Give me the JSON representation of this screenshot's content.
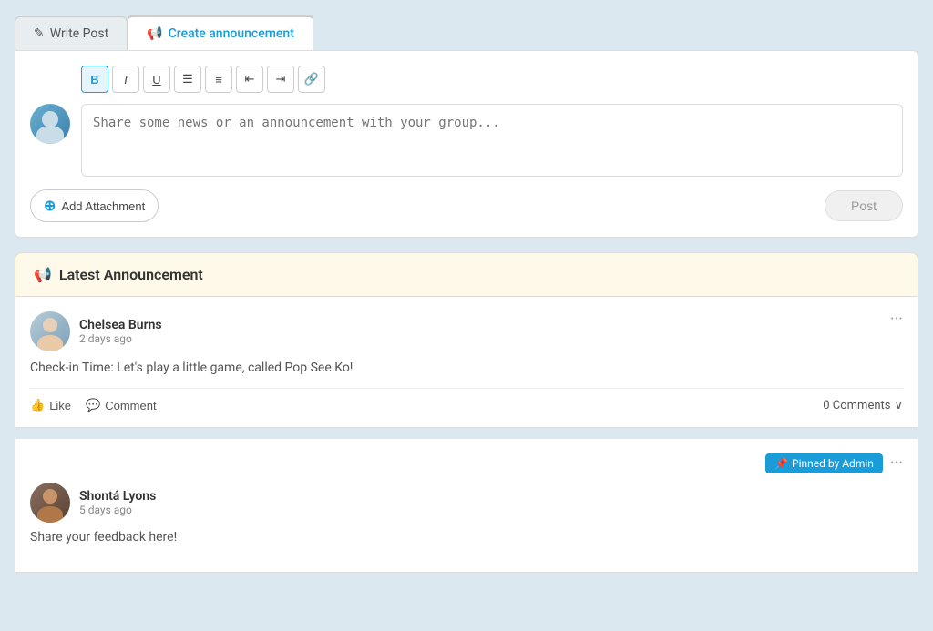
{
  "tabs": [
    {
      "id": "write-post",
      "label": "Write Post",
      "icon": "✎",
      "active": false
    },
    {
      "id": "create-announcement",
      "label": "Create announcement",
      "icon": "📢",
      "active": true
    }
  ],
  "editor": {
    "placeholder": "Share some news or an announcement with your group...",
    "toolbar": [
      {
        "id": "bold",
        "label": "B",
        "active": true
      },
      {
        "id": "italic",
        "label": "I",
        "active": false
      },
      {
        "id": "underline",
        "label": "U",
        "active": false
      },
      {
        "id": "unordered-list",
        "label": "≡",
        "active": false
      },
      {
        "id": "ordered-list",
        "label": "⊟",
        "active": false
      },
      {
        "id": "outdent",
        "label": "⇤",
        "active": false
      },
      {
        "id": "indent",
        "label": "⇥",
        "active": false
      },
      {
        "id": "link",
        "label": "⛓",
        "active": false
      }
    ],
    "add_attachment_label": "Add Attachment",
    "post_button_label": "Post"
  },
  "announcement_section": {
    "icon": "📢",
    "title": "Latest Announcement"
  },
  "posts": [
    {
      "id": "post-1",
      "author": "Chelsea Burns",
      "time": "2 days ago",
      "content": "Check-in Time: Let's play a little game, called Pop See Ko!",
      "like_label": "Like",
      "comment_label": "Comment",
      "comments_count": "0 Comments",
      "pinned": false
    },
    {
      "id": "post-2",
      "author": "Shontá Lyons",
      "time": "5 days ago",
      "content": "Share your feedback here!",
      "pinned": true,
      "pinned_label": "Pinned by Admin"
    }
  ]
}
